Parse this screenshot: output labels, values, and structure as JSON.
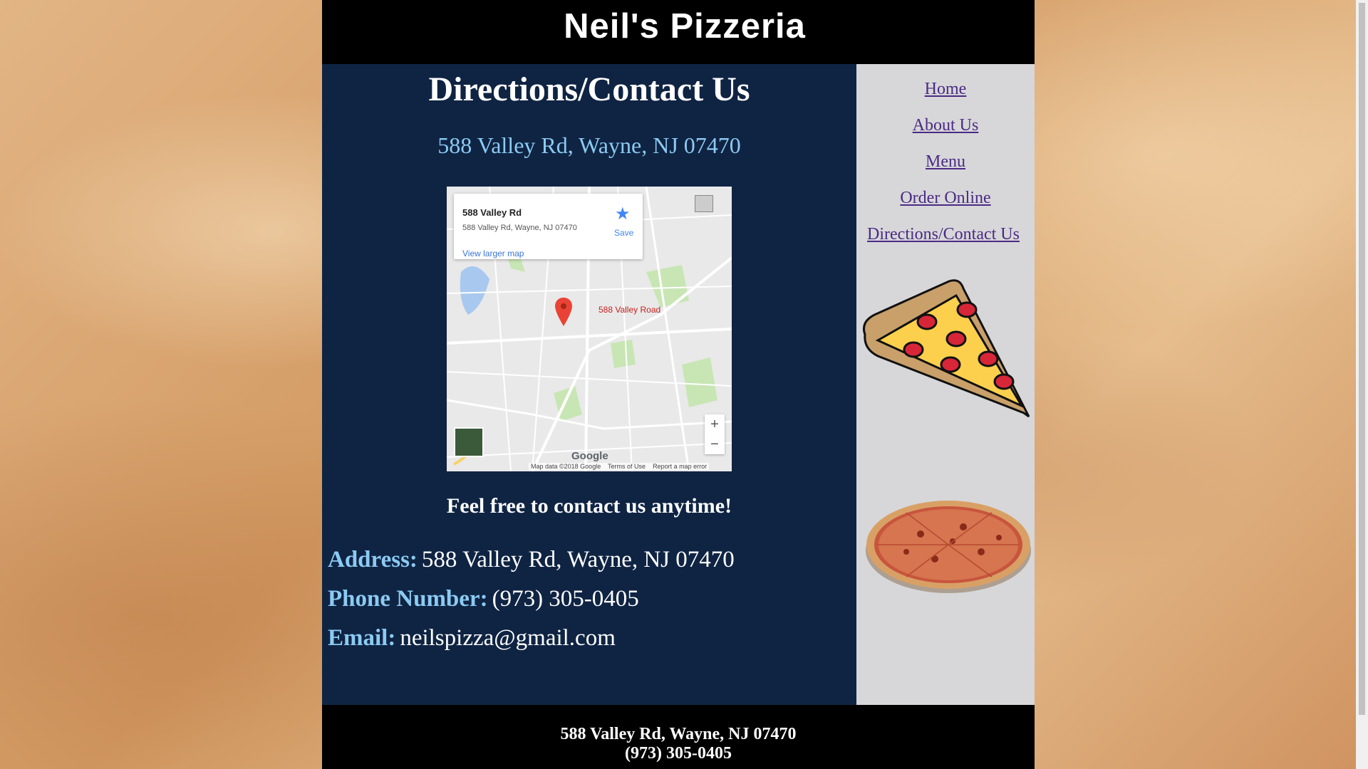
{
  "site": {
    "title": "Neil's Pizzeria"
  },
  "main": {
    "heading": "Directions/Contact Us",
    "address_line": "588 Valley Rd, Wayne, NJ 07470",
    "map": {
      "card_title": "588 Valley Rd",
      "card_address": "588 Valley Rd, Wayne, NJ 07470",
      "save_label": "Save",
      "larger_map_link": "View larger map",
      "pin_label": "588 Valley Road",
      "logo_text": "Google",
      "footer_data": "Map data ©2018 Google",
      "footer_terms": "Terms of Use",
      "footer_report": "Report a map error",
      "zoom_in": "+",
      "zoom_out": "−"
    },
    "contact_heading": "Feel free to contact us anytime!",
    "info": {
      "address_label": "Address:",
      "address_value": "588 Valley Rd, Wayne, NJ 07470",
      "phone_label": "Phone Number:",
      "phone_value": "(973) 305-0405",
      "email_label": "Email:",
      "email_value": "neilspizza@gmail.com"
    }
  },
  "nav": {
    "items": [
      {
        "label": "Home"
      },
      {
        "label": "About Us"
      },
      {
        "label": "Menu"
      },
      {
        "label": "Order Online"
      },
      {
        "label": "Directions/Contact Us"
      }
    ]
  },
  "footer": {
    "address": "588 Valley Rd, Wayne, NJ 07470",
    "phone": "(973) 305-0405"
  },
  "colors": {
    "header_bg": "#000000",
    "main_bg": "#0f2443",
    "accent_blue": "#8ccaf2",
    "sidebar_bg": "#d7d7d9",
    "link": "#4b2a84"
  }
}
